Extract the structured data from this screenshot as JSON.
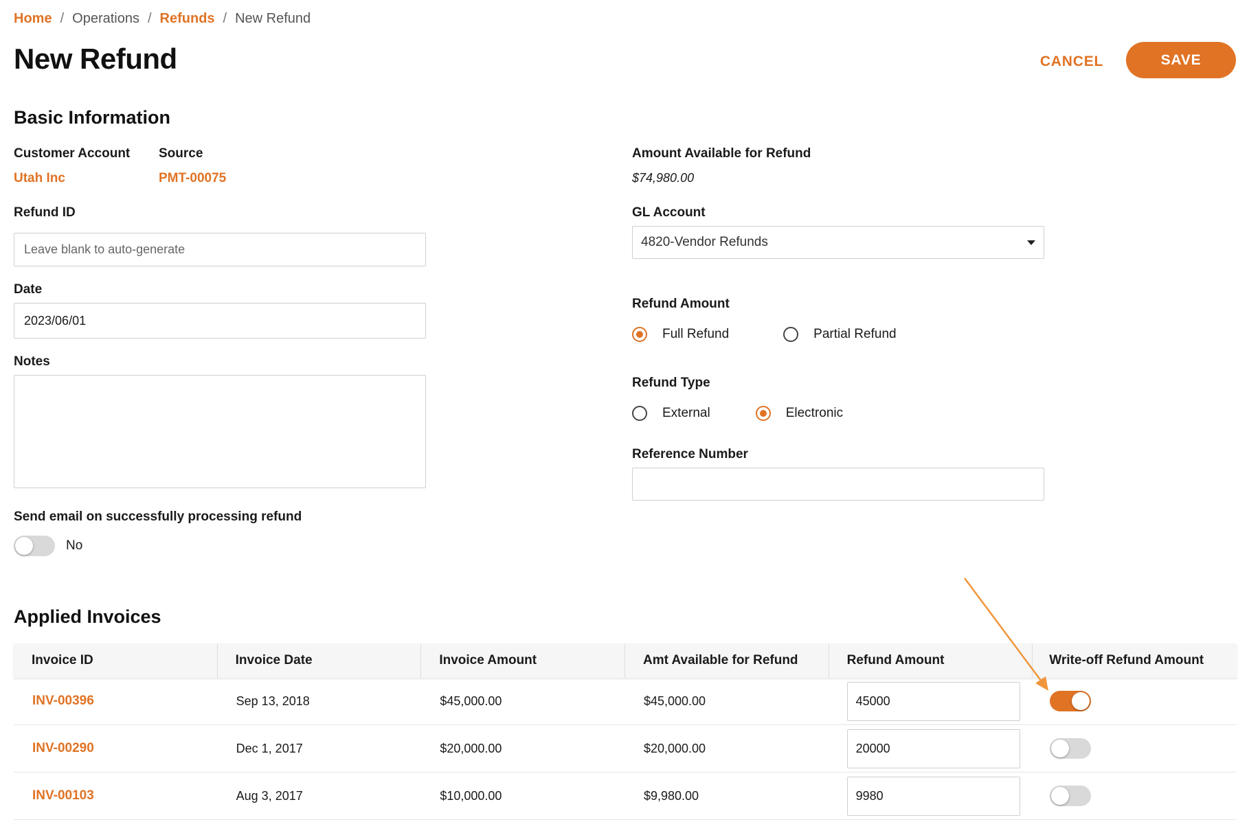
{
  "breadcrumb": {
    "items": [
      {
        "label": "Home",
        "link": true
      },
      {
        "label": "Operations",
        "link": false
      },
      {
        "label": "Refunds",
        "link": true
      },
      {
        "label": "New Refund",
        "link": false
      }
    ],
    "separator": "/"
  },
  "header": {
    "title": "New Refund",
    "cancel_label": "CANCEL",
    "save_label": "SAVE"
  },
  "basic_info": {
    "section_title": "Basic Information",
    "customer_account_label": "Customer Account",
    "customer_account_value": "Utah Inc",
    "source_label": "Source",
    "source_value": "PMT-00075",
    "refund_id_label": "Refund ID",
    "refund_id_value": "",
    "refund_id_placeholder": "Leave blank to auto-generate",
    "date_label": "Date",
    "date_value": "2023/06/01",
    "notes_label": "Notes",
    "notes_value": "",
    "send_email_label": "Send email on successfully processing refund",
    "send_email_state": "No",
    "amount_available_label": "Amount Available for Refund",
    "amount_available_value": "$74,980.00",
    "gl_account_label": "GL Account",
    "gl_account_value": "4820-Vendor Refunds",
    "refund_amount_label": "Refund Amount",
    "refund_amount_options": [
      {
        "label": "Full Refund",
        "selected": true
      },
      {
        "label": "Partial Refund",
        "selected": false
      }
    ],
    "refund_type_label": "Refund Type",
    "refund_type_options": [
      {
        "label": "External",
        "selected": false
      },
      {
        "label": "Electronic",
        "selected": true
      }
    ],
    "reference_number_label": "Reference Number",
    "reference_number_value": ""
  },
  "applied_invoices": {
    "section_title": "Applied Invoices",
    "columns": [
      "Invoice ID",
      "Invoice Date",
      "Invoice Amount",
      "Amt Available for Refund",
      "Refund Amount",
      "Write-off Refund Amount"
    ],
    "rows": [
      {
        "invoice_id": "INV-00396",
        "invoice_date": "Sep 13, 2018",
        "invoice_amount": "$45,000.00",
        "amt_available": "$45,000.00",
        "refund_amount": "45000",
        "write_off": true
      },
      {
        "invoice_id": "INV-00290",
        "invoice_date": "Dec 1, 2017",
        "invoice_amount": "$20,000.00",
        "amt_available": "$20,000.00",
        "refund_amount": "20000",
        "write_off": false
      },
      {
        "invoice_id": "INV-00103",
        "invoice_date": "Aug 3, 2017",
        "invoice_amount": "$10,000.00",
        "amt_available": "$9,980.00",
        "refund_amount": "9980",
        "write_off": false
      }
    ]
  },
  "colors": {
    "accent": "#e07324",
    "annotation_arrow": "#f0963c"
  },
  "icons": {
    "gl_dropdown": "caret-down-icon"
  }
}
